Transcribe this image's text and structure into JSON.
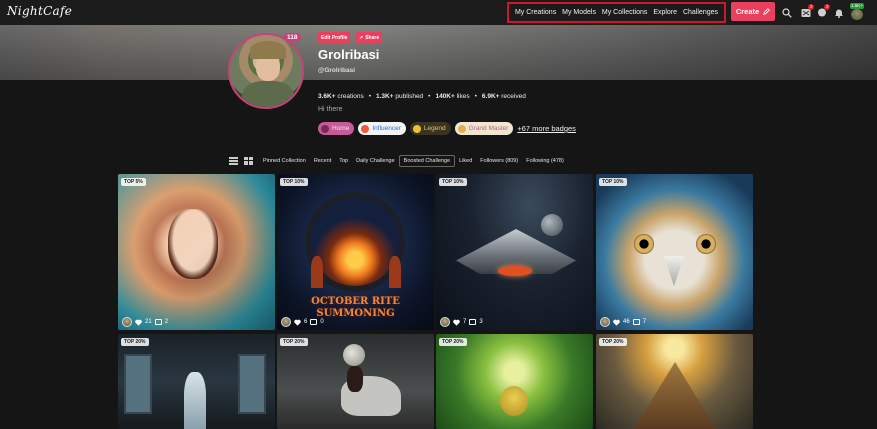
{
  "app": {
    "logo": "NightCafe"
  },
  "nav": {
    "links": [
      "My Creations",
      "My Models",
      "My Collections",
      "Explore",
      "Challenges"
    ],
    "create_label": "Create",
    "messages_badge": "2",
    "chat_badge": "2",
    "user_level": "1.6K+"
  },
  "profile": {
    "avatar_count": "118",
    "edit_label": "Edit Profile",
    "share_label": "Share",
    "name": "Grolribasi",
    "handle": "@Grolribasi",
    "stats": [
      {
        "value": "3.6K+",
        "label": "creations"
      },
      {
        "value": "1.3K+",
        "label": "published"
      },
      {
        "value": "140K+",
        "label": "likes"
      },
      {
        "value": "6.9K+",
        "label": "received"
      }
    ],
    "bio": "Hi there",
    "badges": [
      {
        "label": "Home",
        "icon": "home-badge-icon"
      },
      {
        "label": "Influencer",
        "icon": "influencer-badge-icon"
      },
      {
        "label": "Legend",
        "icon": "legend-badge-icon"
      },
      {
        "label": "Grand Master",
        "icon": "grand-master-badge-icon"
      }
    ],
    "more_badges": "+67 more badges"
  },
  "tabs": [
    "Pinned Collection",
    "Recent",
    "Top",
    "Daily Challenge",
    "Boosted Challenge",
    "Liked",
    "Followers (809)",
    "Following (478)"
  ],
  "active_tab": "Boosted Challenge",
  "gallery": [
    {
      "tag": "TOP 5%",
      "likes": "21",
      "comments": "2"
    },
    {
      "tag": "TOP 10%",
      "likes": "6",
      "comments": "0",
      "poster_line1": "OCTOBER RITE",
      "poster_line2": "SUMMONING"
    },
    {
      "tag": "TOP 10%",
      "likes": "7",
      "comments": "3"
    },
    {
      "tag": "TOP 10%",
      "likes": "46",
      "comments": "7"
    },
    {
      "tag": "TOP 20%"
    },
    {
      "tag": "TOP 20%"
    },
    {
      "tag": "TOP 20%"
    },
    {
      "tag": "TOP 20%"
    }
  ]
}
